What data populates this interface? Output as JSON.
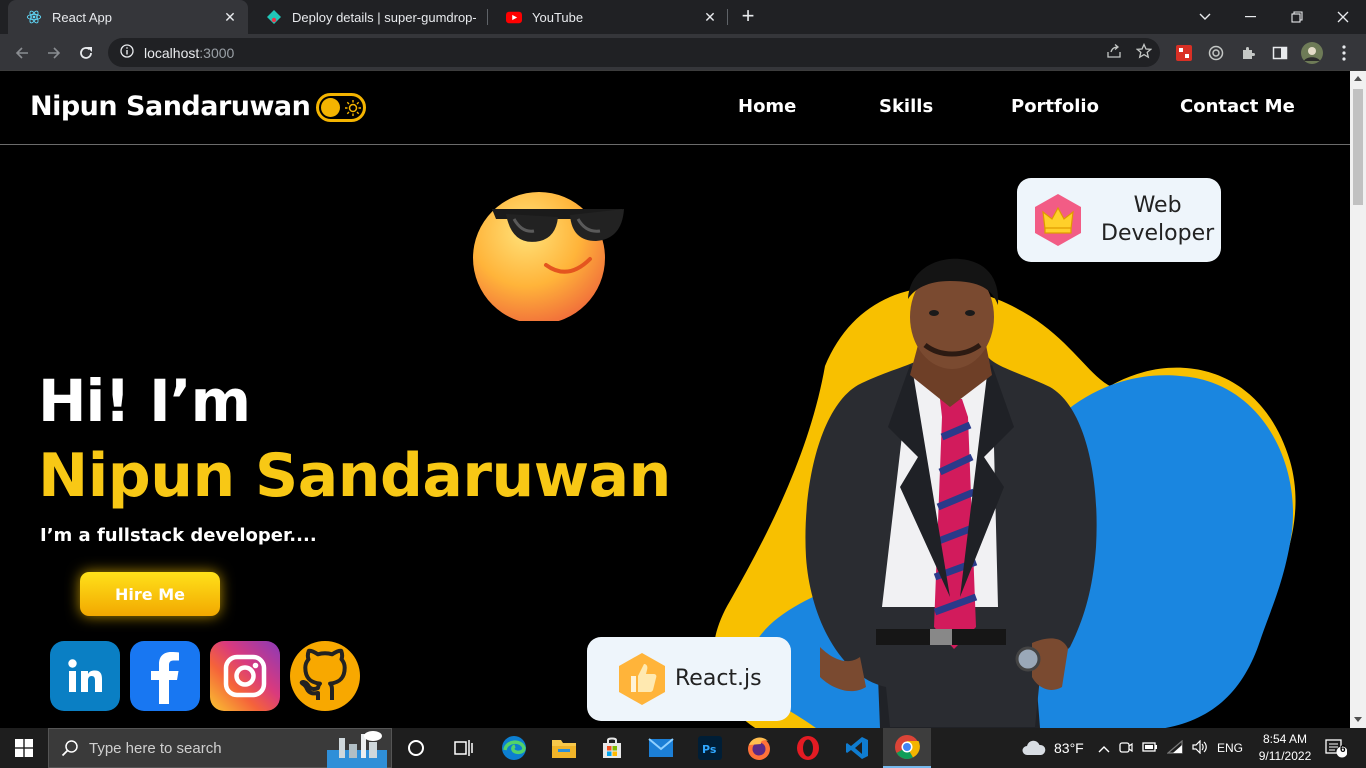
{
  "browser": {
    "tabs": [
      {
        "title": "React App",
        "icon": "react-icon",
        "active": true
      },
      {
        "title": "Deploy details | super-gumdrop-",
        "icon": "netlify-icon",
        "active": false
      },
      {
        "title": "YouTube",
        "icon": "youtube-icon",
        "active": false
      }
    ],
    "url_host": "localhost",
    "url_port": ":3000"
  },
  "site": {
    "brand": "Nipun Sandaruwan",
    "nav": [
      "Home",
      "Skills",
      "Portfolio",
      "Contact Me"
    ],
    "hero": {
      "greeting": "Hi! I’m",
      "name": "Nipun Sandaruwan",
      "subtitle": "I’m a fullstack developer....",
      "cta": "Hire Me"
    },
    "badges": {
      "top": [
        "Web",
        "Developer"
      ],
      "bottom": "React.js"
    },
    "social": [
      "linkedin",
      "facebook",
      "instagram",
      "github"
    ],
    "colors": {
      "accent": "#f8c815",
      "blob_yellow": "#f8c000",
      "blob_blue": "#1a86e0"
    }
  },
  "taskbar": {
    "search_placeholder": "Type here to search",
    "weather": "83°F",
    "language": "ENG",
    "time": "8:54 AM",
    "date": "9/11/2022",
    "notifications": "6"
  }
}
